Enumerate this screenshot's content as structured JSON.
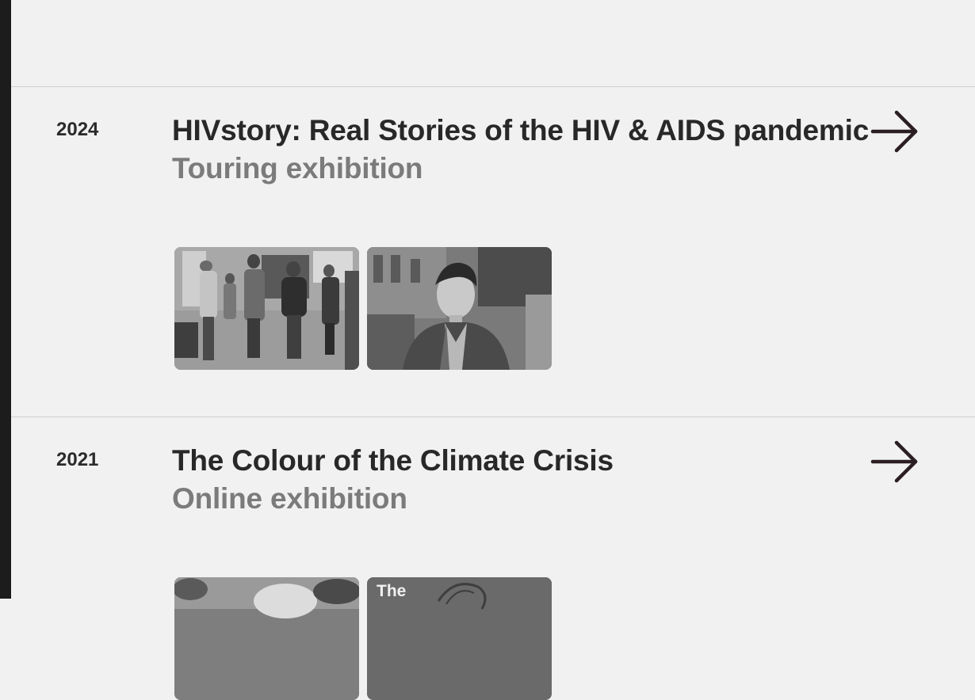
{
  "entries": [
    {
      "year": "2024",
      "title": "HIVstory: Real Stories of the HIV & AIDS pandemic",
      "subtitle": "Touring exhibition",
      "arrow_icon": "arrow-right-icon",
      "thumbnails": [
        "crowd-photo",
        "portrait-photo"
      ]
    },
    {
      "year": "2021",
      "title": "The Colour of the Climate Crisis",
      "subtitle": "Online exhibition",
      "arrow_icon": "arrow-right-icon",
      "thumbnails": [
        "outdoor-photo",
        "cover-photo"
      ],
      "thumbnail_caption": "The"
    }
  ],
  "colors": {
    "background": "#f1f1f1",
    "title": "#282828",
    "subtitle": "#7b7b7b",
    "divider": "#cfcfcf",
    "arrow": "#2b1e23"
  }
}
